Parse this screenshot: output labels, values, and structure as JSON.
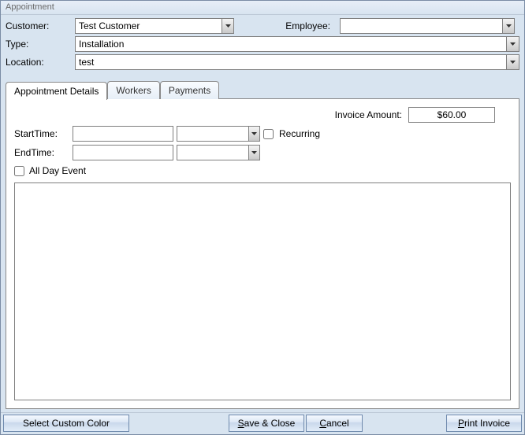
{
  "window": {
    "title": "Appointment"
  },
  "form": {
    "customer_label": "Customer:",
    "customer_value": "Test Customer",
    "employee_label": "Employee:",
    "employee_value": "",
    "type_label": "Type:",
    "type_value": "Installation",
    "location_label": "Location:",
    "location_value": "test"
  },
  "tabs": {
    "details": "Appointment Details",
    "workers": "Workers",
    "payments": "Payments"
  },
  "details": {
    "invoice_label": "Invoice Amount:",
    "invoice_value": "$60.00",
    "start_label": "StartTime:",
    "start_date": "",
    "start_time": "",
    "end_label": "EndTime:",
    "end_date": "",
    "end_time": "",
    "recurring_label": "Recurring",
    "allday_label": "All Day Event",
    "notes": ""
  },
  "buttons": {
    "color": "Select Custom Color",
    "save": "Save & Close",
    "cancel": "Cancel",
    "print": "Print Invoice"
  }
}
